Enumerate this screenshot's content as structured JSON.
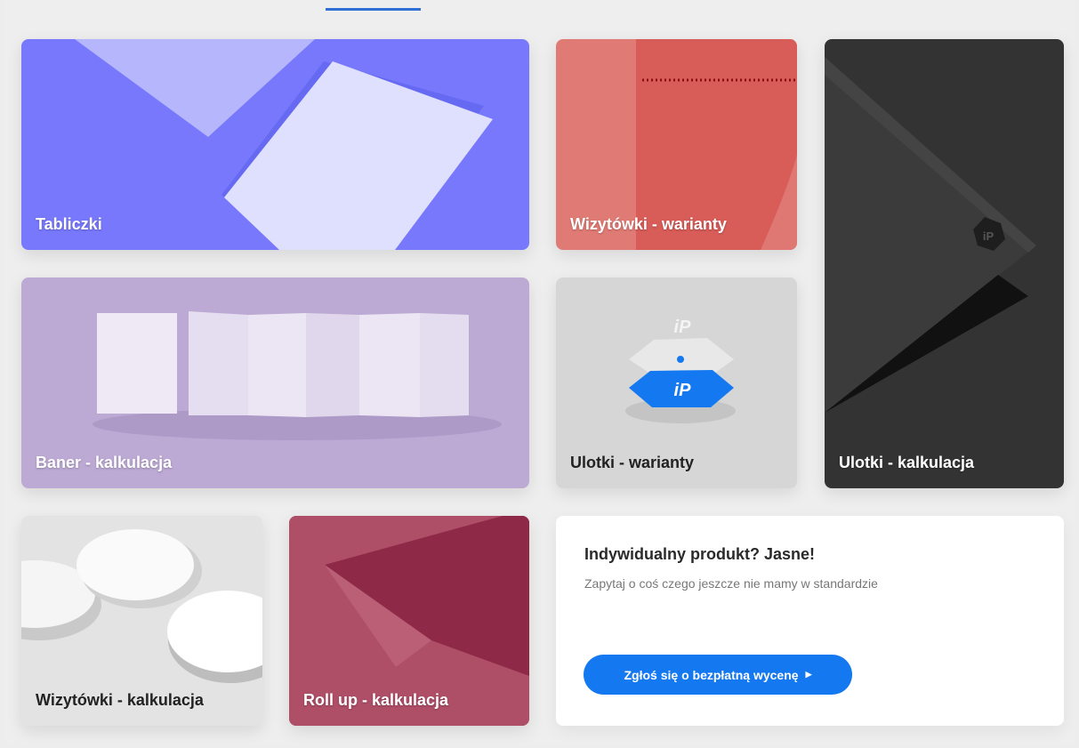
{
  "tiles": {
    "tabliczki": {
      "label": "Tabliczki"
    },
    "wizytowki_warianty": {
      "label": "Wizytówki - warianty"
    },
    "ulotki_kalkulacja": {
      "label": "Ulotki - kalkulacja"
    },
    "baner_kalkulacja": {
      "label": "Baner - kalkulacja"
    },
    "ulotki_warianty": {
      "label": "Ulotki - warianty"
    },
    "wizytowki_kalkulacja": {
      "label": "Wizytówki - kalkulacja"
    },
    "rollup_kalkulacja": {
      "label": "Roll up - kalkulacja"
    }
  },
  "promo": {
    "title": "Indywidualny produkt? Jasne!",
    "subtitle": "Zapytaj o coś czego jeszcze nie mamy w standardzie",
    "button_label": "Zgłoś się o bezpłatną wycenę",
    "button_icon": "play-arrow-icon"
  },
  "logo_text": "iP",
  "colors": {
    "tabliczki": "#7778fc",
    "wizytowki_warianty": "#e07a74",
    "ulotki_kalkulacja": "#333333",
    "baner_kalkulacja": "#bca9d4",
    "ulotki_warianty": "#d6d6d6",
    "wizytowki_kalkulacja": "#e3e3e3",
    "rollup_kalkulacja": "#b05069",
    "accent": "#1479f0",
    "tab_indicator": "#2f6fd6"
  }
}
